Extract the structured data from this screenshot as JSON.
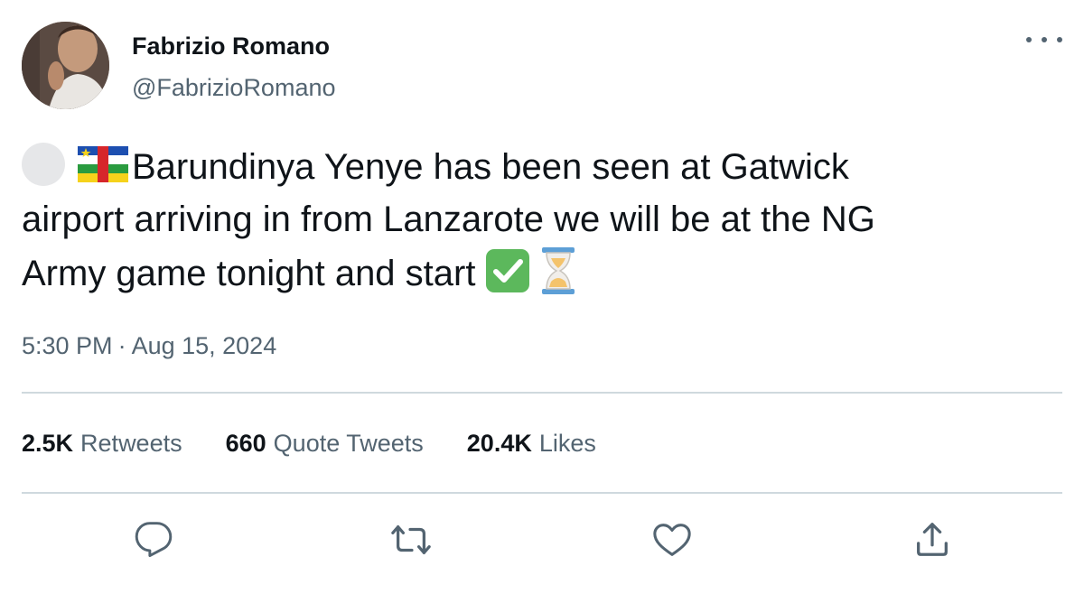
{
  "author": {
    "display_name": "Fabrizio Romano",
    "handle": "@FabrizioRomano"
  },
  "tweet": {
    "line1": "Barundinya Yenye has been seen at Gatwick",
    "line2": "airport arriving in from Lanzarote we will be at the NG",
    "line3": "Army game tonight and start",
    "emojis": [
      "grey-circle",
      "central-african-republic-flag",
      "check-mark-button",
      "hourglass"
    ]
  },
  "meta": {
    "time": "5:30 PM",
    "separator": "·",
    "date": "Aug 15, 2024"
  },
  "stats": {
    "retweets_count": "2.5K",
    "retweets_label": "Retweets",
    "quotes_count": "660",
    "quotes_label": "Quote Tweets",
    "likes_count": "20.4K",
    "likes_label": "Likes"
  },
  "colors": {
    "text_primary": "#0f1419",
    "text_secondary": "#536471",
    "divider": "#cfd9de",
    "check_green": "#5cb85c",
    "hourglass_blue": "#5d9fd6",
    "sand": "#f4c36b"
  },
  "icons": {
    "more": "more-dots-icon",
    "reply": "reply-icon",
    "retweet": "retweet-icon",
    "like": "heart-icon",
    "share": "share-icon"
  }
}
